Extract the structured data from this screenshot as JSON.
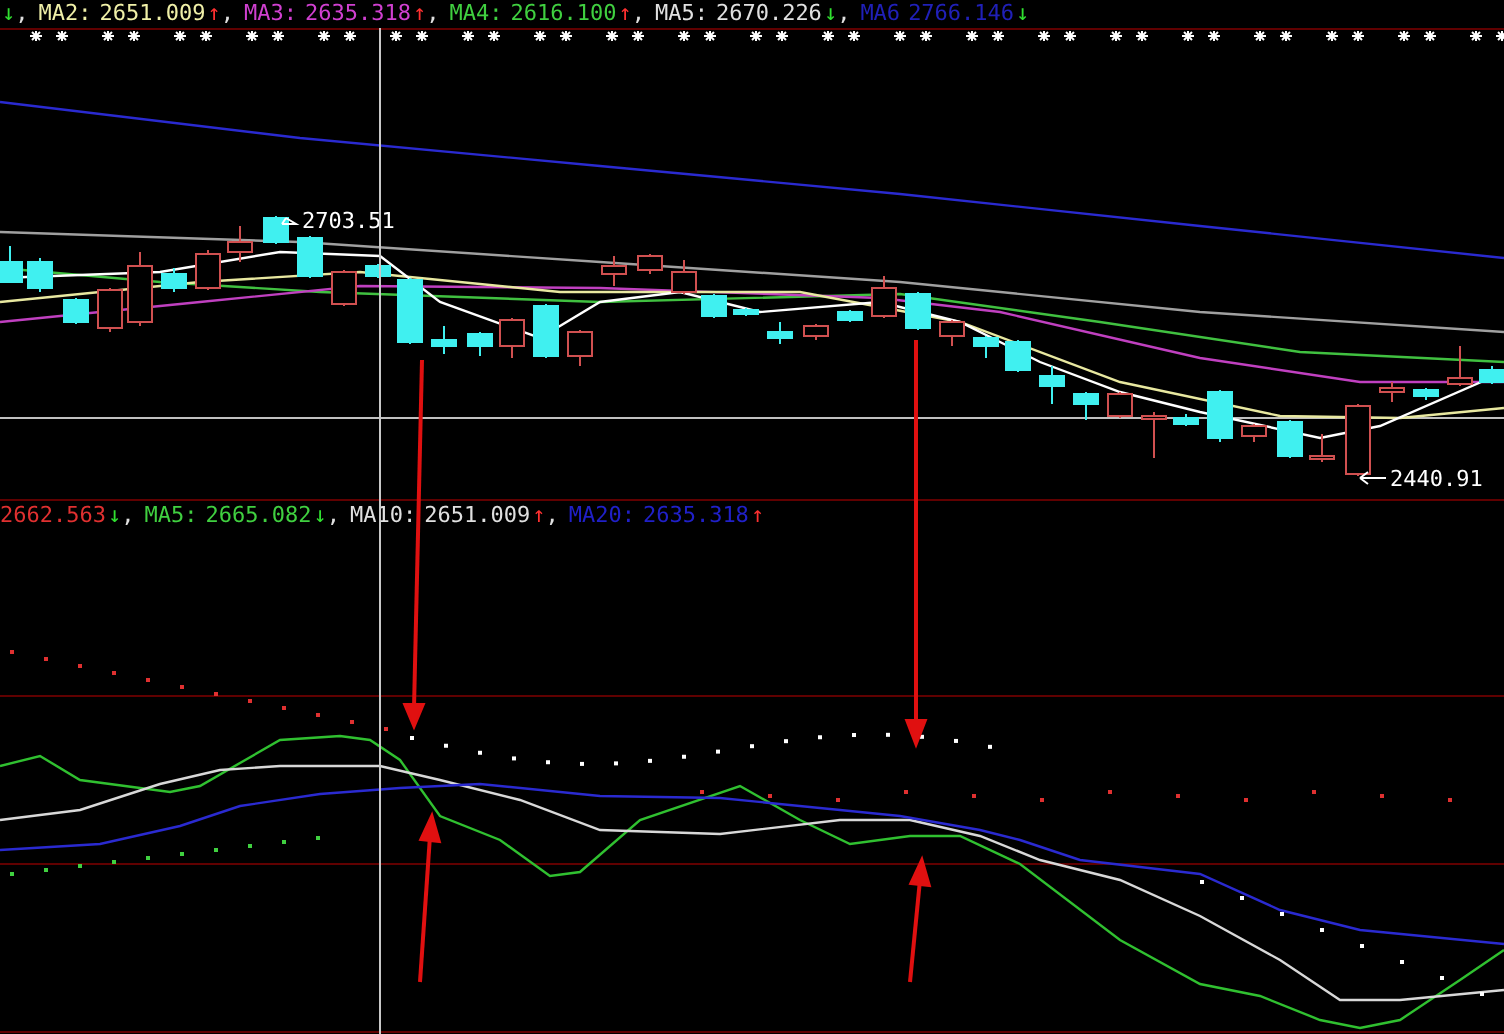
{
  "top_legend": [
    {
      "arrow": "↓",
      "rising": false,
      "sep": ","
    },
    {
      "label": "MA2:",
      "value": "2651.009",
      "color": "#f0f0a8",
      "arrow": "↑",
      "rising": true,
      "sep": ","
    },
    {
      "label": "MA3:",
      "value": "2635.318",
      "color": "#d040d0",
      "arrow": "↑",
      "rising": true,
      "sep": ","
    },
    {
      "label": "MA4:",
      "value": "2616.100",
      "color": "#40d040",
      "arrow": "↑",
      "rising": true,
      "sep": ","
    },
    {
      "label": "MA5:",
      "value": "2670.226",
      "color": "#e0e0e0",
      "arrow": "↓",
      "rising": false,
      "sep": ","
    },
    {
      "label": "MA6",
      "value": "2766.146",
      "color": "#2020b8",
      "arrow": "↓",
      "rising": false
    }
  ],
  "price_labels": [
    "2703.51",
    "2440.91"
  ],
  "indicator_legend": [
    {
      "value": "2662.563",
      "color": "#e03030",
      "arrow": "↓",
      "rising": false,
      "sep": ","
    },
    {
      "label": "MA5:",
      "value": "2665.082",
      "color": "#40d040",
      "arrow": "↓",
      "rising": false,
      "sep": ","
    },
    {
      "label": "MA10:",
      "value": "2651.009",
      "color": "#e0e0e0",
      "arrow": "↑",
      "rising": true,
      "sep": ","
    },
    {
      "label": "MA20:",
      "value": "2635.318",
      "color": "#2020c8",
      "arrow": "↑",
      "rising": true
    }
  ]
}
